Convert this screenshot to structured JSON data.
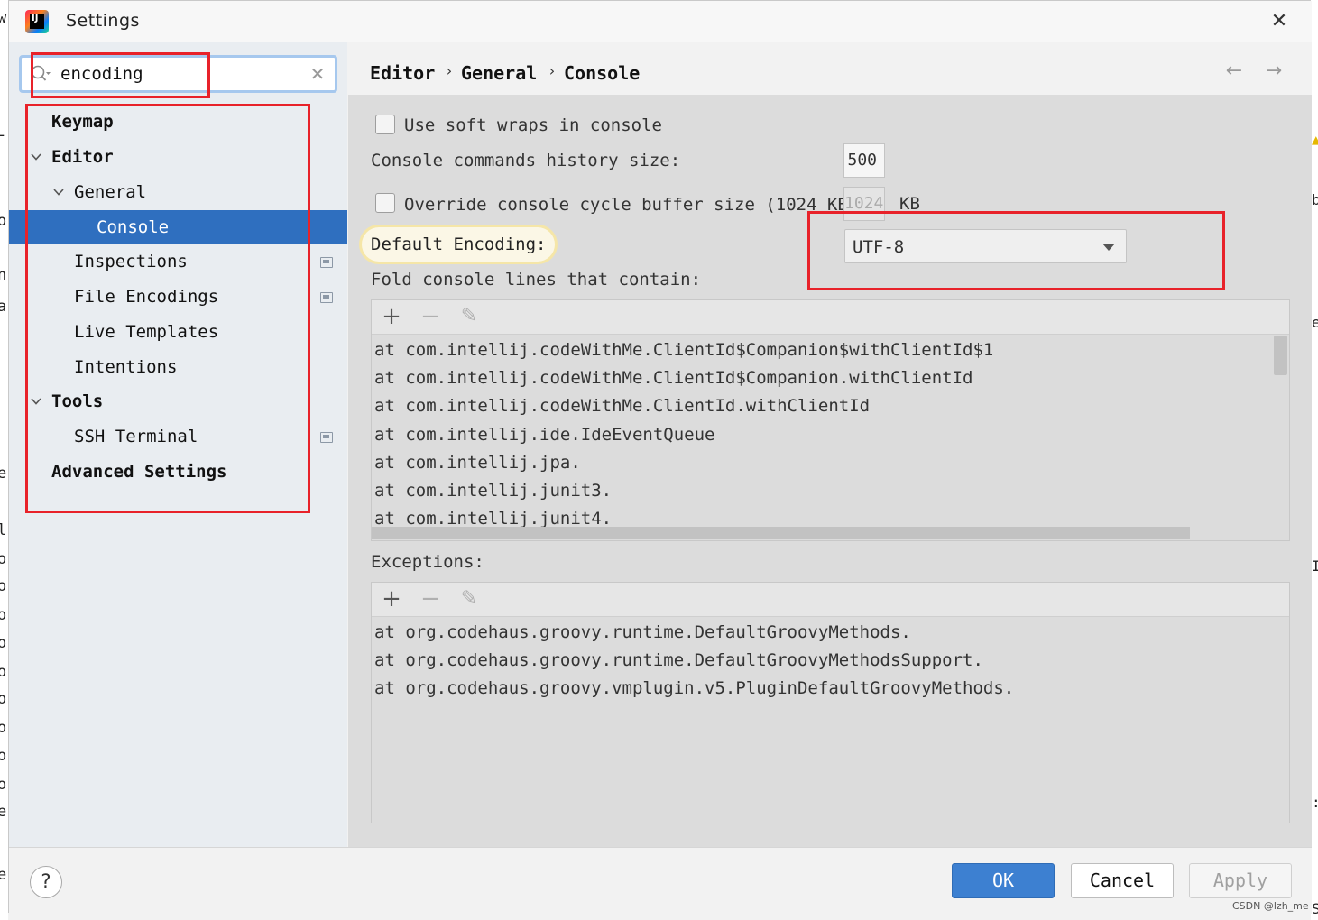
{
  "window": {
    "title": "Settings",
    "close_glyph": "✕"
  },
  "search": {
    "value": "encoding",
    "clear_glyph": "✕"
  },
  "tree": [
    {
      "label": "Keymap"
    },
    {
      "label": "Editor"
    },
    {
      "label": "General"
    },
    {
      "label": "Console"
    },
    {
      "label": "Inspections"
    },
    {
      "label": "File Encodings"
    },
    {
      "label": "Live Templates"
    },
    {
      "label": "Intentions"
    },
    {
      "label": "Tools"
    },
    {
      "label": "SSH Terminal"
    },
    {
      "label": "Advanced Settings"
    }
  ],
  "breadcrumb": {
    "items": [
      "Editor",
      "General",
      "Console"
    ],
    "separator": "›",
    "back_glyph": "←",
    "forward_glyph": "→"
  },
  "console": {
    "soft_wraps_label": "Use soft wraps in console",
    "history_label": "Console commands history size:",
    "history_value": "500",
    "override_label": "Override console cycle buffer size (1024 KB)",
    "override_value": "1024",
    "override_unit": "KB",
    "encoding_label": "Default Encoding:",
    "encoding_value": "UTF-8",
    "fold_label": "Fold console lines that contain:",
    "fold_lines": [
      "at com.intellij.codeWithMe.ClientId$Companion$withClientId$1",
      "at com.intellij.codeWithMe.ClientId$Companion.withClientId",
      "at com.intellij.codeWithMe.ClientId.withClientId",
      "at com.intellij.ide.IdeEventQueue",
      "at com.intellij.jpa.",
      "at com.intellij.junit3.",
      "at com.intellij.junit4."
    ],
    "exceptions_label": "Exceptions:",
    "exception_lines": [
      "at org.codehaus.groovy.runtime.DefaultGroovyMethods.",
      "at org.codehaus.groovy.runtime.DefaultGroovyMethodsSupport.",
      "at org.codehaus.groovy.vmplugin.v5.PluginDefaultGroovyMethods."
    ],
    "toolbar": {
      "add_glyph": "+",
      "remove_glyph": "−",
      "edit_glyph": "✎"
    }
  },
  "buttons": {
    "help": "?",
    "ok": "OK",
    "cancel": "Cancel",
    "apply": "Apply"
  },
  "watermark": "CSDN @lzh_me",
  "colors": {
    "selection": "#2f6fbf",
    "ok_button": "#3d80d1",
    "annotation_red": "#e8222a",
    "search_border": "#a6c8ee"
  }
}
